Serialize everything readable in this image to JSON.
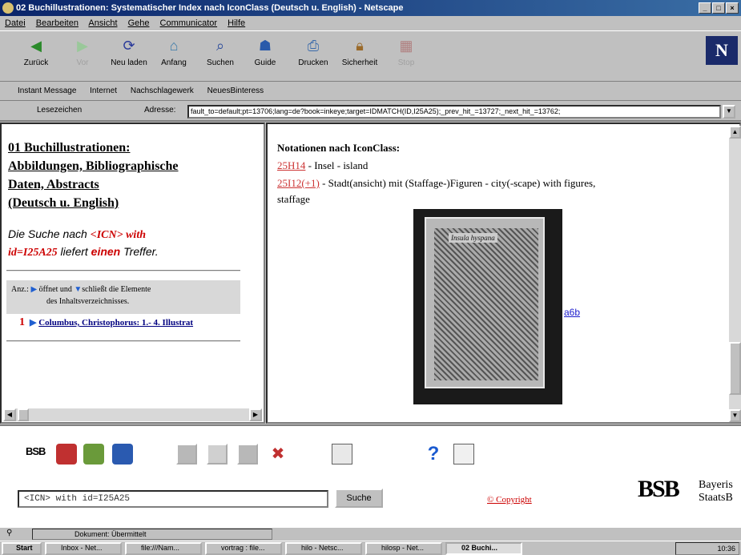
{
  "window": {
    "title": "02 Buchillustrationen: Systematischer Index nach IconClass (Deutsch u. English) - Netscape",
    "controls": [
      "_",
      "□",
      "×"
    ]
  },
  "menu": [
    "Datei",
    "Bearbeiten",
    "Ansicht",
    "Gehe",
    "Communicator",
    "Hilfe"
  ],
  "navbar": {
    "back": "Zurück",
    "forward": "Vor",
    "reload": "Neu laden",
    "home": "Anfang",
    "search": "Suchen",
    "guide": "Guide",
    "print": "Drucken",
    "security": "Sicherheit",
    "stop": "Stop",
    "logo": "N"
  },
  "personalbar": [
    "Instant Message",
    "Internet",
    "Nachschlagewerk",
    "NeuesBinteress"
  ],
  "location": {
    "bookmarks_label": "Lesezeichen",
    "address_label": "Adresse:",
    "url": "fault_to=default;pt=13706;lang=de?book=inkeye;target=IDMATCH(ID,I25A25);_prev_hit_=13727;_next_hit_=13762;"
  },
  "left": {
    "title_lines": [
      "01 Buchillustrationen:",
      "Abbildungen, Bibliographische",
      "Daten, Abstracts",
      "(Deutsch u. English)"
    ],
    "search_pre": "Die Suche nach ",
    "search_term": "<ICN> with",
    "search_id": "id=I25A25",
    "search_mid": " liefert ",
    "search_count": "einen",
    "search_post": " Treffer.",
    "legend_pre": "Anz.:",
    "legend_open": " öffnet und ",
    "legend_close": "schließt die Elemente",
    "legend_line2": "des Inhaltsverzeichnisses.",
    "hit_number": "1",
    "hit_text": "Columbus, Christophorus: 1.- 4. Illustrat"
  },
  "right": {
    "heading": "Notationen nach IconClass:",
    "notation1_code": "25H14",
    "notation1_text": " - Insel - island",
    "notation2_code": "25I12(+1)",
    "notation2_text": " - Stadt(ansicht) mit (Staffage-)Figuren - city(-scape) with figures,",
    "notation2_cont": "staffage",
    "image_caption": "Insula hyspana",
    "image_link": "a6b"
  },
  "bottom": {
    "bsb_small": "BSB",
    "search_value": "<ICN> with id=I25A25",
    "search_button": "Suche",
    "copyright": "© Copyright",
    "bsb_big": "BSB",
    "bay_line1": "Bayeris",
    "bay_line2": "StaatsB"
  },
  "status": {
    "text": "Dokument: Übermittelt"
  },
  "taskbar": {
    "start": "Start",
    "items": [
      "Inbox - Net...",
      "file:///Nam...",
      "vortrag : file...",
      "hilo - Netsc...",
      "hilosp - Net...",
      "02 Buchi..."
    ],
    "clock": "10:36"
  }
}
